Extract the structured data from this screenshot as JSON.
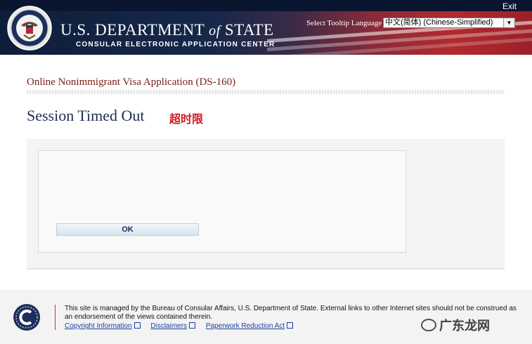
{
  "header": {
    "exit_label": "Exit",
    "dept_title_pre": "U.S. DEPARTMENT ",
    "dept_title_of": "of",
    "dept_title_post": " STATE",
    "dept_subtitle": "CONSULAR ELECTRONIC APPLICATION CENTER",
    "tooltip_language_label": "Select Tooltip Language",
    "tooltip_language_value": "中文(简体)  (Chinese-Simplified)"
  },
  "main": {
    "app_title": "Online Nonimmigrant Visa Application (DS-160)",
    "page_title": "Session Timed Out",
    "page_title_cn": "超时限",
    "ok_label": "OK"
  },
  "footer": {
    "text": "This site is managed by the Bureau of Consular Affairs, U.S. Department of State. External links to other Internet sites should not be construed as an endorsement of the views contained therein.",
    "links": [
      "Copyright Information",
      "Disclaimers",
      "Paperwork Reduction Act"
    ]
  },
  "watermark": "广东龙网",
  "colors": {
    "app_title": "#7b1c14",
    "page_title": "#1d2d50",
    "page_title_cn": "#d2191c",
    "link": "#1a3fa0"
  }
}
